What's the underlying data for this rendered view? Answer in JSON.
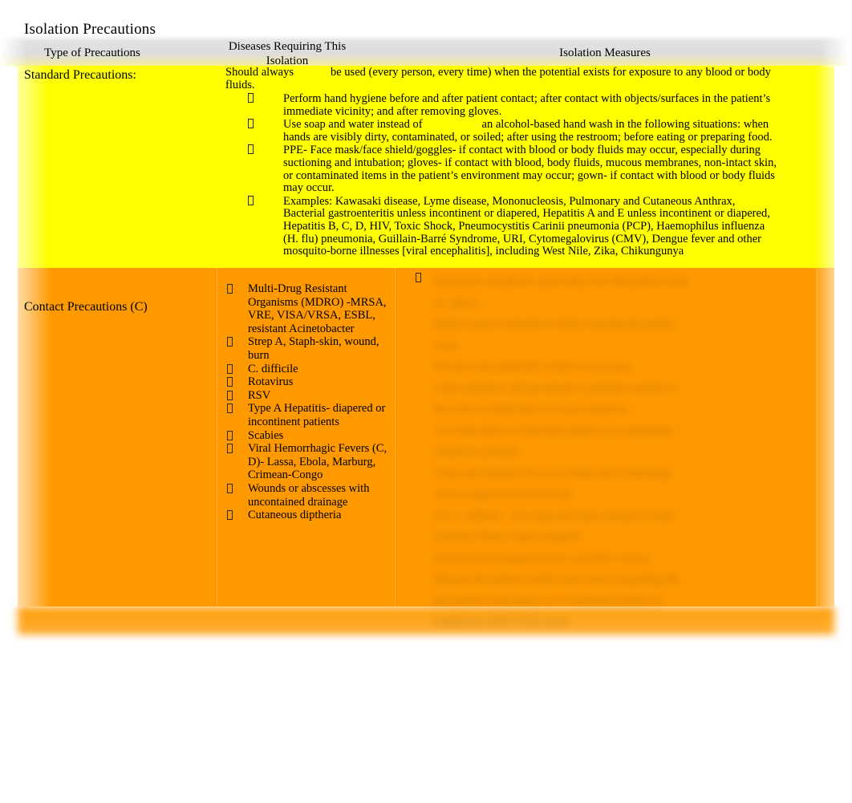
{
  "document": {
    "title": "Isolation Precautions"
  },
  "table": {
    "headers": {
      "col1": "Type of Precautions",
      "col2": "Diseases Requiring This Isolation",
      "col3": "Isolation Measures"
    },
    "rows": [
      {
        "id": "standard",
        "label": "Standard Precautions:",
        "accent_color": "#ffff00",
        "measures_lead_before": "Should always",
        "measures_lead_after": "be used (every person, every time) when the potential exists for exposure to any blood or body fluids.",
        "measures_bullets": [
          {
            "text_before": "Perform hand hygiene before and after patient contact; after contact with objects/surfaces in the patient’s immediate vicinity; and after removing gloves.",
            "gap": false,
            "text_after": ""
          },
          {
            "text_before": "Use soap and water instead of",
            "gap": true,
            "text_after": "an alcohol-based hand wash in the following situations: when hands are visibly dirty, contaminated, or soiled; after using the restroom; before eating or preparing food."
          },
          {
            "text_before": "PPE- Face mask/face shield/goggles- if contact with blood or body fluids may occur, especially during suctioning and intubation; gloves- if contact with blood, body fluids, mucous membranes, non-intact skin, or contaminated items in the patient’s environment may occur; gown- if contact with blood or body fluids may occur.",
            "gap": false,
            "text_after": ""
          },
          {
            "text_before": "Examples: Kawasaki disease, Lyme disease, Mononucleosis, Pulmonary and Cutaneous Anthrax, Bacterial gastroenteritis unless incontinent or diapered, Hepatitis A and E unless incontinent or diapered, Hepatitis B, C, D, HIV, Toxic Shock, Pneumocystitis Carinii pneumonia (PCP), Haemophilus influenza (H. flu) pneumonia, Guillain-Barré Syndrome, URI, Cytomegalovirus (CMV), Dengue fever and other mosquito-borne illnesses [viral encephalitis], including West Nile, Zika, Chikungunya",
            "gap": false,
            "text_after": ""
          }
        ]
      },
      {
        "id": "contact",
        "label": "Contact Precautions (C)",
        "accent_color": "#ff9900",
        "diseases": [
          "Multi-Drug Resistant Organisms (MDRO) -MRSA, VRE, VISA/VRSA, ESBL, resistant Acinetobacter",
          "Strep A, Staph-skin, wound, burn",
          "C. difficile",
          "Rotavirus",
          "RSV",
          "Type A Hepatitis- diapered or incontinent patients",
          "Scabies",
          "Viral Hemorrhagic Fevers (C, D)- Lassa, Ebola, Marburg, Crimean-Congo",
          "Wounds or abscesses with uncontained drainage",
          "Cutaneous diptheria"
        ],
        "measures_illegible_lines": [
          "",
          "",
          "",
          "",
          "",
          "",
          "",
          "",
          "",
          "",
          "",
          "",
          "",
          "",
          ""
        ]
      }
    ]
  },
  "style": {
    "page_background": "#ffffff",
    "header_gradient_top": "#ffffff",
    "header_gradient_mid": "#dddde0",
    "header_gradient_bottom": "#fcfa78",
    "text_color": "#000000"
  }
}
